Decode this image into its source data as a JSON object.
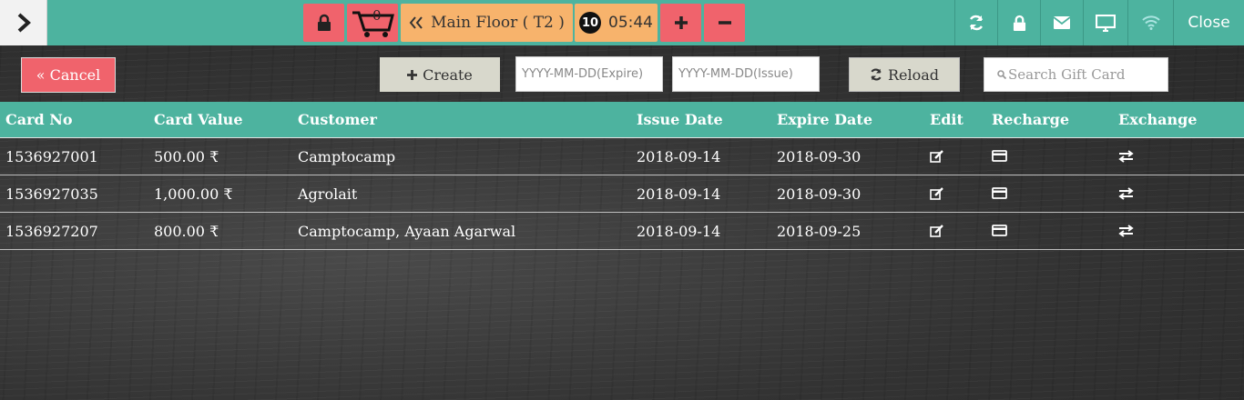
{
  "topbar": {
    "cart_count": "0",
    "floor_label": "Main Floor ( T2 )",
    "order_count": "10",
    "timer": "05:44",
    "close_label": "Close"
  },
  "toolbar": {
    "cancel_label": "« Cancel",
    "create_label": "Create",
    "expire_placeholder": "YYYY-MM-DD(Expire)",
    "issue_placeholder": "YYYY-MM-DD(Issue)",
    "reload_label": "Reload",
    "search_placeholder": "Search Gift Card"
  },
  "table": {
    "headers": [
      "Card No",
      "Card Value",
      "Customer",
      "Issue Date",
      "Expire Date",
      "Edit",
      "Recharge",
      "Exchange"
    ],
    "rows": [
      {
        "card_no": "1536927001",
        "value": "500.00 ₹",
        "customer": "Camptocamp",
        "issue": "2018-09-14",
        "expire": "2018-09-30"
      },
      {
        "card_no": "1536927035",
        "value": "1,000.00 ₹",
        "customer": "Agrolait",
        "issue": "2018-09-14",
        "expire": "2018-09-30"
      },
      {
        "card_no": "1536927207",
        "value": "800.00 ₹",
        "customer": "Camptocamp, Ayaan Agarwal",
        "issue": "2018-09-14",
        "expire": "2018-09-25"
      }
    ]
  },
  "colors": {
    "teal": "#4db39f",
    "red": "#f0636c",
    "orange": "#f7b36c",
    "gray_button": "#d8d8cc"
  },
  "icons": [
    "chevron-right-icon",
    "lock-icon",
    "cart-icon",
    "double-chevron-left-icon",
    "plus-icon",
    "minus-icon",
    "refresh-icon",
    "envelope-icon",
    "monitor-icon",
    "wifi-icon",
    "edit-icon",
    "credit-card-icon",
    "exchange-icon",
    "search-icon"
  ]
}
